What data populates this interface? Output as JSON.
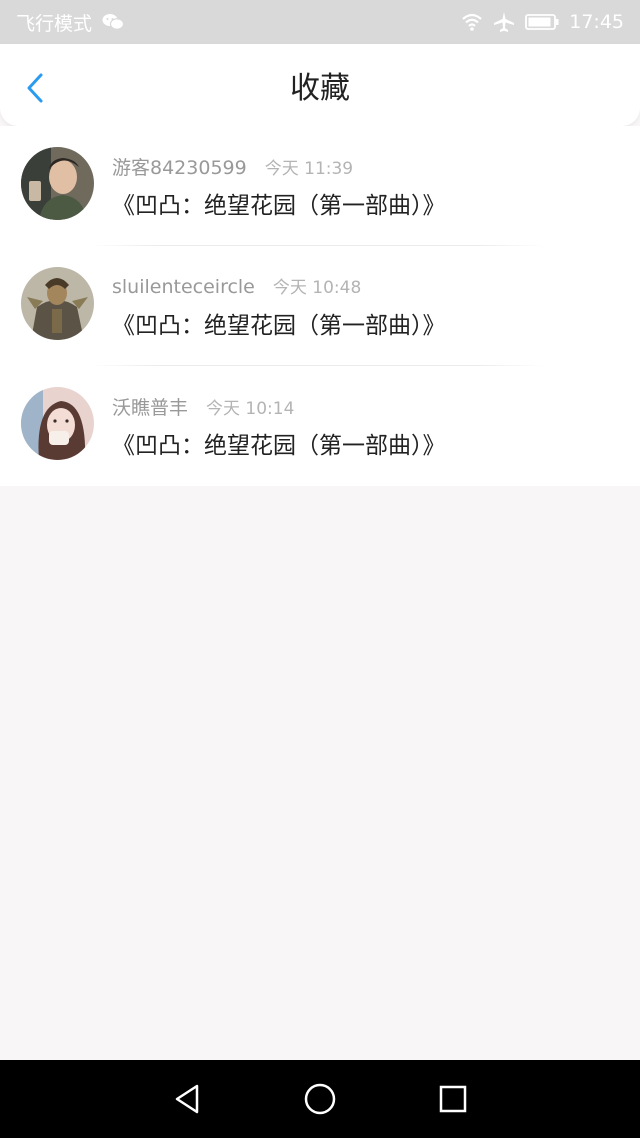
{
  "status_bar": {
    "carrier": "飞行模式",
    "time": "17:45"
  },
  "nav": {
    "title": "收藏"
  },
  "favorites": [
    {
      "user": "游客84230599",
      "time": "今天 11:39",
      "title": "《凹凸：绝望花园（第一部曲）》"
    },
    {
      "user": "sluilenteceircle",
      "time": "今天 10:48",
      "title": "《凹凸：绝望花园（第一部曲）》"
    },
    {
      "user": "沃瞧普丰",
      "time": "今天 10:14",
      "title": "《凹凸：绝望花园（第一部曲）》"
    }
  ],
  "colors": {
    "accent": "#2a9bf0",
    "status_bar_bg": "#d9d9d9",
    "page_bg": "#f8f6f7"
  },
  "icons": {
    "back": "chevron-left-icon",
    "wechat": "wechat-icon",
    "wifi": "wifi-icon",
    "airplane": "airplane-icon",
    "battery": "battery-icon",
    "sys_back": "triangle-back-icon",
    "sys_home": "circle-home-icon",
    "sys_recent": "square-recent-icon"
  }
}
